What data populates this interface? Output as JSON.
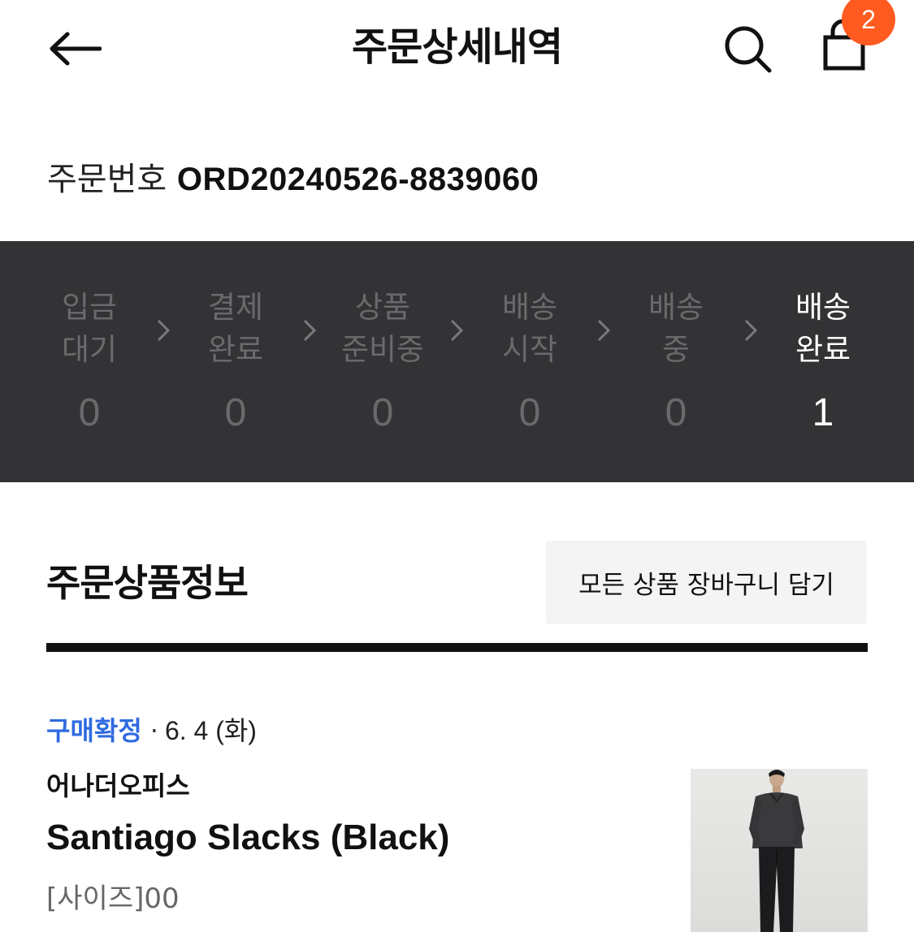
{
  "header": {
    "title": "주문상세내역",
    "cart_count": "2"
  },
  "order": {
    "number_label": "주문번호",
    "number_value": "ORD20240526-8839060"
  },
  "steps": [
    {
      "label": "입금\n대기",
      "count": "0"
    },
    {
      "label": "결제\n완료",
      "count": "0"
    },
    {
      "label": "상품\n준비중",
      "count": "0"
    },
    {
      "label": "배송\n시작",
      "count": "0"
    },
    {
      "label": "배송\n중",
      "count": "0"
    },
    {
      "label": "배송\n완료",
      "count": "1"
    }
  ],
  "products_section": {
    "title": "주문상품정보",
    "add_all_to_cart": "모든 상품 장바구니 담기"
  },
  "item": {
    "status": "구매확정",
    "separator": "·",
    "date": "6. 4 (화)",
    "brand": "어나더오피스",
    "name": "Santiago Slacks (Black)",
    "option": "[사이즈]00"
  },
  "colors": {
    "accent_badge": "#ff5a1f",
    "status_blue": "#2f6ae0",
    "status_bar_bg": "#333335"
  }
}
